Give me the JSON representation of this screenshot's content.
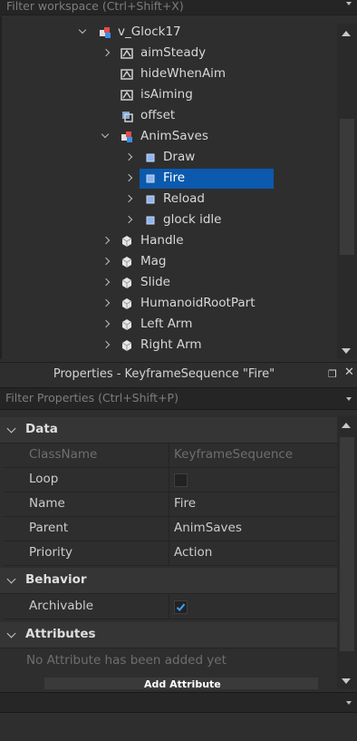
{
  "explorer": {
    "filter_placeholder": "Filter workspace (Ctrl+Shift+X)",
    "items": [
      {
        "label": "v_Glock17",
        "icon": "model-icon",
        "expander": "expanded"
      },
      {
        "label": "aimSteady",
        "icon": "bool-value-icon",
        "expander": "collapsed"
      },
      {
        "label": "hideWhenAim",
        "icon": "bool-value-icon",
        "expander": "none"
      },
      {
        "label": "isAiming",
        "icon": "bool-value-icon",
        "expander": "none"
      },
      {
        "label": "offset",
        "icon": "cframe-value-icon",
        "expander": "none"
      },
      {
        "label": "AnimSaves",
        "icon": "model-icon",
        "expander": "expanded"
      },
      {
        "label": "Draw",
        "icon": "keyframe-sequence-icon",
        "expander": "collapsed"
      },
      {
        "label": "Fire",
        "icon": "keyframe-sequence-icon",
        "expander": "collapsed",
        "selected": true
      },
      {
        "label": "Reload",
        "icon": "keyframe-sequence-icon",
        "expander": "collapsed"
      },
      {
        "label": "glock idle",
        "icon": "keyframe-sequence-icon",
        "expander": "collapsed"
      },
      {
        "label": "Handle",
        "icon": "part-icon",
        "expander": "collapsed"
      },
      {
        "label": "Mag",
        "icon": "part-icon",
        "expander": "collapsed"
      },
      {
        "label": "Slide",
        "icon": "part-icon",
        "expander": "collapsed"
      },
      {
        "label": "HumanoidRootPart",
        "icon": "part-icon",
        "expander": "collapsed"
      },
      {
        "label": "Left Arm",
        "icon": "part-icon",
        "expander": "collapsed"
      },
      {
        "label": "Right Arm",
        "icon": "part-icon",
        "expander": "collapsed"
      }
    ]
  },
  "properties": {
    "title": "Properties - KeyframeSequence \"Fire\"",
    "filter_placeholder": "Filter Properties (Ctrl+Shift+P)",
    "sections": {
      "data": {
        "label": "Data",
        "rows": [
          {
            "name": "ClassName",
            "value": "KeyframeSequence"
          },
          {
            "name": "Loop",
            "value": ""
          },
          {
            "name": "Name",
            "value": "Fire"
          },
          {
            "name": "Parent",
            "value": "AnimSaves"
          },
          {
            "name": "Priority",
            "value": "Action"
          }
        ]
      },
      "behavior": {
        "label": "Behavior",
        "rows": [
          {
            "name": "Archivable",
            "value": ""
          }
        ]
      },
      "attributes": {
        "label": "Attributes",
        "empty_text": "No Attribute has been added yet",
        "add_button": "Add Attribute"
      }
    },
    "loop_checked": false,
    "archivable_checked": true
  },
  "colors": {
    "selection": "#0b5aad",
    "panel_bg": "#2e2e2e",
    "check_accent": "#3ca0ff"
  }
}
